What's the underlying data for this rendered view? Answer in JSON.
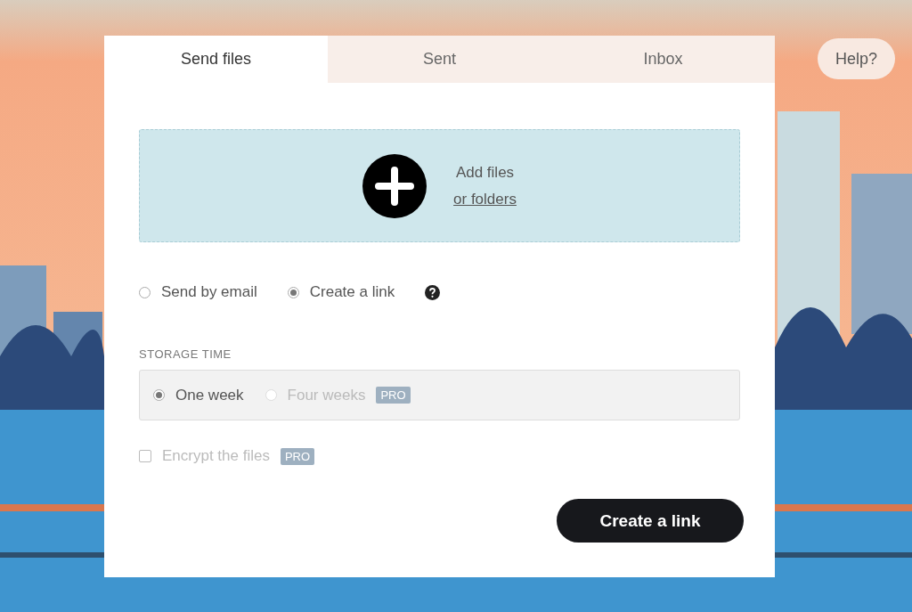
{
  "tabs": [
    {
      "label": "Send files",
      "selected": true
    },
    {
      "label": "Sent",
      "selected": false
    },
    {
      "label": "Inbox",
      "selected": false
    }
  ],
  "help_button": "Help?",
  "drop_zone": {
    "title": "Add files",
    "link": "or folders"
  },
  "send_modes": [
    {
      "label": "Send by email",
      "selected": false
    },
    {
      "label": "Create a link",
      "selected": true
    }
  ],
  "storage_time": {
    "label": "STORAGE TIME",
    "options": [
      {
        "label": "One week",
        "selected": true,
        "disabled": false
      },
      {
        "label": "Four weeks",
        "selected": false,
        "disabled": true,
        "badge": "PRO"
      }
    ]
  },
  "encrypt": {
    "label": "Encrypt the files",
    "checked": false,
    "disabled": true,
    "badge": "PRO"
  },
  "submit_button": "Create a link"
}
